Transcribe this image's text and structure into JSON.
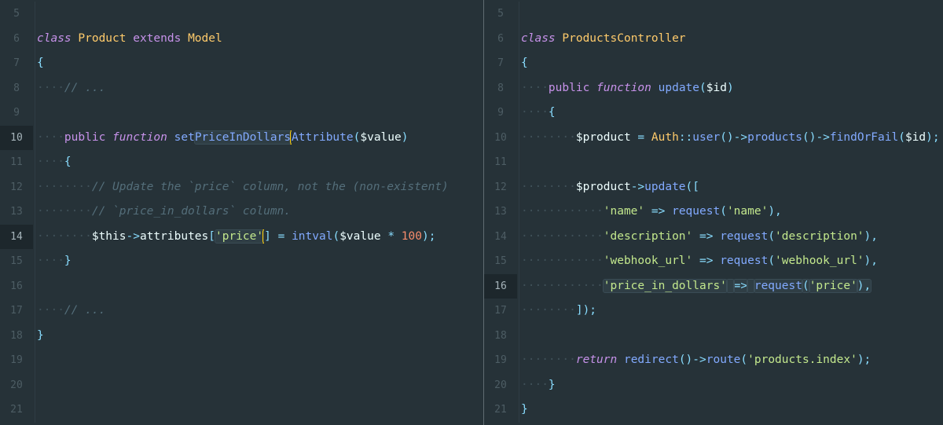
{
  "left_pane": {
    "lines": [
      {
        "n": "5",
        "current": false,
        "tokens": []
      },
      {
        "n": "6",
        "current": false,
        "tokens": [
          {
            "t": "class",
            "c": "kw"
          },
          {
            "t": " ",
            "c": "txt"
          },
          {
            "t": "Product",
            "c": "cls"
          },
          {
            "t": " ",
            "c": "txt"
          },
          {
            "t": "extends",
            "c": "pl"
          },
          {
            "t": " ",
            "c": "txt"
          },
          {
            "t": "Model",
            "c": "cls"
          }
        ]
      },
      {
        "n": "7",
        "current": false,
        "tokens": [
          {
            "t": "{",
            "c": "br"
          }
        ]
      },
      {
        "n": "8",
        "current": false,
        "tokens": [
          {
            "t": "····",
            "c": "ws"
          },
          {
            "t": "// ...",
            "c": "com"
          }
        ]
      },
      {
        "n": "9",
        "current": false,
        "tokens": []
      },
      {
        "n": "10",
        "current": true,
        "tokens": [
          {
            "t": "····",
            "c": "ws"
          },
          {
            "t": "public",
            "c": "pl"
          },
          {
            "t": " ",
            "c": "txt"
          },
          {
            "t": "function",
            "c": "kw"
          },
          {
            "t": " ",
            "c": "txt"
          },
          {
            "t": "set",
            "c": "fn"
          },
          {
            "t": "PriceInDollars",
            "c": "fn hl"
          },
          {
            "t": "|",
            "c": "cursor"
          },
          {
            "t": "Attribute",
            "c": "fn"
          },
          {
            "t": "(",
            "c": "br"
          },
          {
            "t": "$value",
            "c": "var"
          },
          {
            "t": ")",
            "c": "br"
          }
        ]
      },
      {
        "n": "11",
        "current": false,
        "tokens": [
          {
            "t": "····",
            "c": "ws"
          },
          {
            "t": "{",
            "c": "br"
          }
        ]
      },
      {
        "n": "12",
        "current": false,
        "tokens": [
          {
            "t": "········",
            "c": "ws"
          },
          {
            "t": "// Update the `price` column, not the (non-existent)",
            "c": "com"
          }
        ]
      },
      {
        "n": "13",
        "current": false,
        "tokens": [
          {
            "t": "········",
            "c": "ws"
          },
          {
            "t": "// `price_in_dollars` column.",
            "c": "com"
          }
        ]
      },
      {
        "n": "14",
        "current": true,
        "tokens": [
          {
            "t": "········",
            "c": "ws"
          },
          {
            "t": "$this",
            "c": "var"
          },
          {
            "t": "->",
            "c": "op"
          },
          {
            "t": "attributes",
            "c": "var"
          },
          {
            "t": "[",
            "c": "br"
          },
          {
            "t": "'price'",
            "c": "str hl"
          },
          {
            "t": "|",
            "c": "cursor"
          },
          {
            "t": "]",
            "c": "br"
          },
          {
            "t": " ",
            "c": "txt"
          },
          {
            "t": "=",
            "c": "op"
          },
          {
            "t": " ",
            "c": "txt"
          },
          {
            "t": "intval",
            "c": "fn"
          },
          {
            "t": "(",
            "c": "br"
          },
          {
            "t": "$value",
            "c": "var"
          },
          {
            "t": " ",
            "c": "txt"
          },
          {
            "t": "*",
            "c": "op"
          },
          {
            "t": " ",
            "c": "txt"
          },
          {
            "t": "100",
            "c": "num"
          },
          {
            "t": ");",
            "c": "br"
          }
        ]
      },
      {
        "n": "15",
        "current": false,
        "tokens": [
          {
            "t": "····",
            "c": "ws"
          },
          {
            "t": "}",
            "c": "br"
          }
        ]
      },
      {
        "n": "16",
        "current": false,
        "tokens": []
      },
      {
        "n": "17",
        "current": false,
        "tokens": [
          {
            "t": "····",
            "c": "ws"
          },
          {
            "t": "// ...",
            "c": "com"
          }
        ]
      },
      {
        "n": "18",
        "current": false,
        "tokens": [
          {
            "t": "}",
            "c": "br"
          }
        ]
      },
      {
        "n": "19",
        "current": false,
        "tokens": []
      },
      {
        "n": "20",
        "current": false,
        "tokens": []
      },
      {
        "n": "21",
        "current": false,
        "tokens": []
      }
    ]
  },
  "right_pane": {
    "lines": [
      {
        "n": "5",
        "current": false,
        "tokens": []
      },
      {
        "n": "6",
        "current": false,
        "tokens": [
          {
            "t": "class",
            "c": "kw"
          },
          {
            "t": " ",
            "c": "txt"
          },
          {
            "t": "ProductsController",
            "c": "cls"
          }
        ]
      },
      {
        "n": "7",
        "current": false,
        "tokens": [
          {
            "t": "{",
            "c": "br"
          }
        ]
      },
      {
        "n": "8",
        "current": false,
        "tokens": [
          {
            "t": "····",
            "c": "ws"
          },
          {
            "t": "public",
            "c": "pl"
          },
          {
            "t": " ",
            "c": "txt"
          },
          {
            "t": "function",
            "c": "kw"
          },
          {
            "t": " ",
            "c": "txt"
          },
          {
            "t": "update",
            "c": "fn"
          },
          {
            "t": "(",
            "c": "br"
          },
          {
            "t": "$id",
            "c": "var"
          },
          {
            "t": ")",
            "c": "br"
          }
        ]
      },
      {
        "n": "9",
        "current": false,
        "tokens": [
          {
            "t": "····",
            "c": "ws"
          },
          {
            "t": "{",
            "c": "br"
          }
        ]
      },
      {
        "n": "10",
        "current": false,
        "tokens": [
          {
            "t": "········",
            "c": "ws"
          },
          {
            "t": "$product",
            "c": "var"
          },
          {
            "t": " ",
            "c": "txt"
          },
          {
            "t": "=",
            "c": "op"
          },
          {
            "t": " ",
            "c": "txt"
          },
          {
            "t": "Auth",
            "c": "cls"
          },
          {
            "t": "::",
            "c": "op"
          },
          {
            "t": "user",
            "c": "fn"
          },
          {
            "t": "()",
            "c": "br"
          },
          {
            "t": "->",
            "c": "op"
          },
          {
            "t": "products",
            "c": "fn"
          },
          {
            "t": "()",
            "c": "br"
          },
          {
            "t": "->",
            "c": "op"
          },
          {
            "t": "findOrFail",
            "c": "fn"
          },
          {
            "t": "(",
            "c": "br"
          },
          {
            "t": "$id",
            "c": "var"
          },
          {
            "t": ");",
            "c": "br"
          }
        ]
      },
      {
        "n": "11",
        "current": false,
        "tokens": []
      },
      {
        "n": "12",
        "current": false,
        "tokens": [
          {
            "t": "········",
            "c": "ws"
          },
          {
            "t": "$product",
            "c": "var"
          },
          {
            "t": "->",
            "c": "op"
          },
          {
            "t": "update",
            "c": "fn"
          },
          {
            "t": "([",
            "c": "br"
          }
        ]
      },
      {
        "n": "13",
        "current": false,
        "tokens": [
          {
            "t": "············",
            "c": "ws"
          },
          {
            "t": "'name'",
            "c": "str"
          },
          {
            "t": " ",
            "c": "txt"
          },
          {
            "t": "=>",
            "c": "op"
          },
          {
            "t": " ",
            "c": "txt"
          },
          {
            "t": "request",
            "c": "fn"
          },
          {
            "t": "(",
            "c": "br"
          },
          {
            "t": "'name'",
            "c": "str"
          },
          {
            "t": "),",
            "c": "br"
          }
        ]
      },
      {
        "n": "14",
        "current": false,
        "tokens": [
          {
            "t": "············",
            "c": "ws"
          },
          {
            "t": "'description'",
            "c": "str"
          },
          {
            "t": " ",
            "c": "txt"
          },
          {
            "t": "=>",
            "c": "op"
          },
          {
            "t": " ",
            "c": "txt"
          },
          {
            "t": "request",
            "c": "fn"
          },
          {
            "t": "(",
            "c": "br"
          },
          {
            "t": "'description'",
            "c": "str"
          },
          {
            "t": "),",
            "c": "br"
          }
        ]
      },
      {
        "n": "15",
        "current": false,
        "tokens": [
          {
            "t": "············",
            "c": "ws"
          },
          {
            "t": "'webhook_url'",
            "c": "str"
          },
          {
            "t": " ",
            "c": "txt"
          },
          {
            "t": "=>",
            "c": "op"
          },
          {
            "t": " ",
            "c": "txt"
          },
          {
            "t": "request",
            "c": "fn"
          },
          {
            "t": "(",
            "c": "br"
          },
          {
            "t": "'webhook_url'",
            "c": "str"
          },
          {
            "t": "),",
            "c": "br"
          }
        ]
      },
      {
        "n": "16",
        "current": true,
        "tokens": [
          {
            "t": "············",
            "c": "ws"
          },
          {
            "t": "'price_in_dollars'",
            "c": "str hl"
          },
          {
            "t": " ",
            "c": "txt hl"
          },
          {
            "t": "=>",
            "c": "op hl"
          },
          {
            "t": " ",
            "c": "txt hl"
          },
          {
            "t": "request",
            "c": "fn hl"
          },
          {
            "t": "(",
            "c": "br hl"
          },
          {
            "t": "'price'",
            "c": "str hl"
          },
          {
            "t": "),",
            "c": "br hl"
          }
        ]
      },
      {
        "n": "17",
        "current": false,
        "tokens": [
          {
            "t": "········",
            "c": "ws"
          },
          {
            "t": "]);",
            "c": "br"
          }
        ]
      },
      {
        "n": "18",
        "current": false,
        "tokens": []
      },
      {
        "n": "19",
        "current": false,
        "tokens": [
          {
            "t": "········",
            "c": "ws"
          },
          {
            "t": "return",
            "c": "kw"
          },
          {
            "t": " ",
            "c": "txt"
          },
          {
            "t": "redirect",
            "c": "fn"
          },
          {
            "t": "()",
            "c": "br"
          },
          {
            "t": "->",
            "c": "op"
          },
          {
            "t": "route",
            "c": "fn"
          },
          {
            "t": "(",
            "c": "br"
          },
          {
            "t": "'products.index'",
            "c": "str"
          },
          {
            "t": ");",
            "c": "br"
          }
        ]
      },
      {
        "n": "20",
        "current": false,
        "tokens": [
          {
            "t": "····",
            "c": "ws"
          },
          {
            "t": "}",
            "c": "br"
          }
        ]
      },
      {
        "n": "21",
        "current": false,
        "tokens": [
          {
            "t": "}",
            "c": "br"
          }
        ]
      }
    ]
  }
}
